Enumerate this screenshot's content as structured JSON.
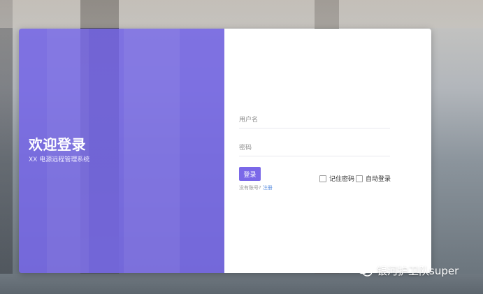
{
  "left_panel": {
    "title": "欢迎登录",
    "subtitle": "XX 电源远程管理系统"
  },
  "form": {
    "username_placeholder": "用户名",
    "password_placeholder": "密码",
    "login_button": "登录",
    "remember_label": "记住密码",
    "auto_login_label": "自动登录",
    "no_account_text": "没有账号?",
    "register_link": "注册"
  },
  "watermark": {
    "text": "银河护卫队super",
    "icon": "wechat-icon"
  },
  "colors": {
    "accent": "#7a68e8",
    "left_panel_bg": "#7566e6",
    "link": "#5b8fe0"
  }
}
